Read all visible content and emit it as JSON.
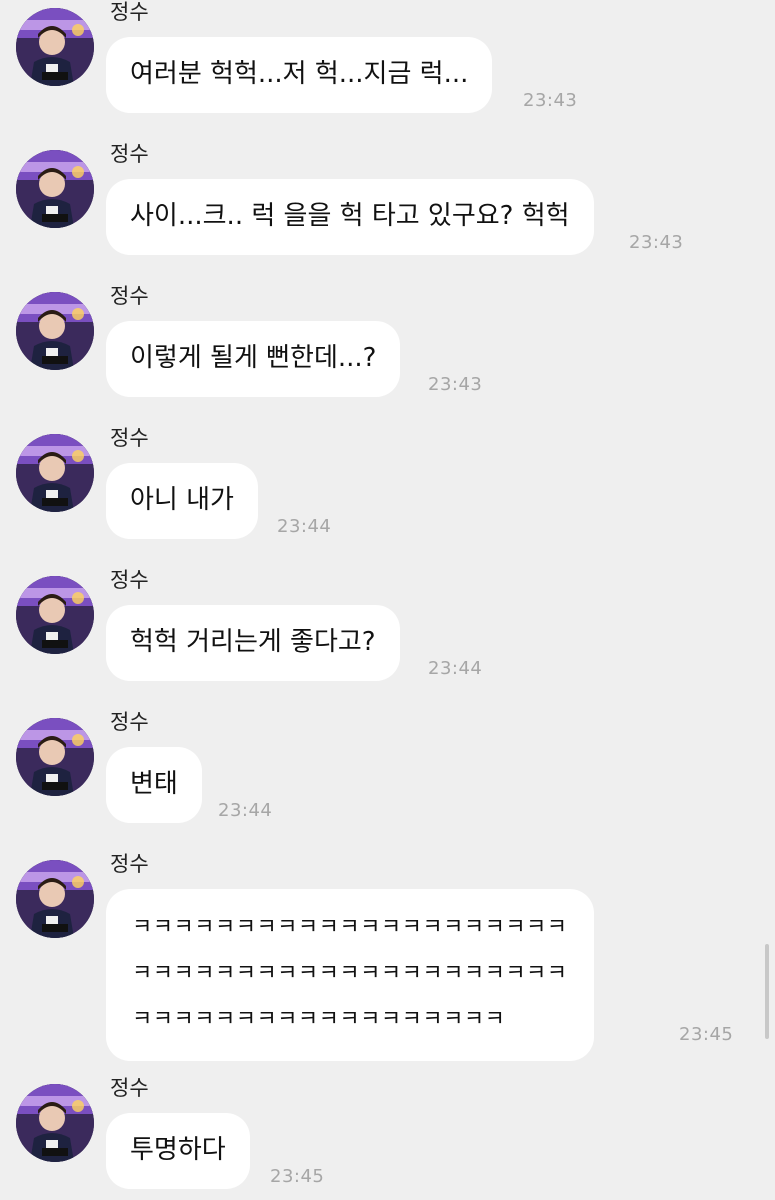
{
  "messages": [
    {
      "sender": "정수",
      "text": "여러분 헉헉...저 헉...지금 럭...",
      "time": "23:43"
    },
    {
      "sender": "정수",
      "text": "사이...크.. 럭 을을 헉 타고 있구요? 헉헉",
      "time": "23:43"
    },
    {
      "sender": "정수",
      "text": "이렇게 될게 뻔한데...?",
      "time": "23:43"
    },
    {
      "sender": "정수",
      "text": "아니 내가",
      "time": "23:44"
    },
    {
      "sender": "정수",
      "text": "헉헉 거리는게 좋다고?",
      "time": "23:44"
    },
    {
      "sender": "정수",
      "text": "변태",
      "time": "23:44"
    },
    {
      "sender": "정수",
      "text": "ㅋㅋㅋㅋㅋㅋㅋㅋㅋㅋㅋㅋㅋㅋㅋㅋㅋㅋㅋㅋㅋ\nㅋㅋㅋㅋㅋㅋㅋㅋㅋㅋㅋㅋㅋㅋㅋㅋㅋㅋㅋㅋㅋ\nㅋㅋㅋㅋㅋㅋㅋㅋㅋㅋㅋㅋㅋㅋㅋㅋㅋㅋ",
      "time": "23:45"
    },
    {
      "sender": "정수",
      "text": "투명하다",
      "time": "23:45"
    }
  ],
  "icons": {
    "avatar": "profile-photo"
  },
  "colors": {
    "background": "#efefef",
    "bubble": "#ffffff",
    "timestamp": "#a6a6a6",
    "text": "#111111"
  }
}
